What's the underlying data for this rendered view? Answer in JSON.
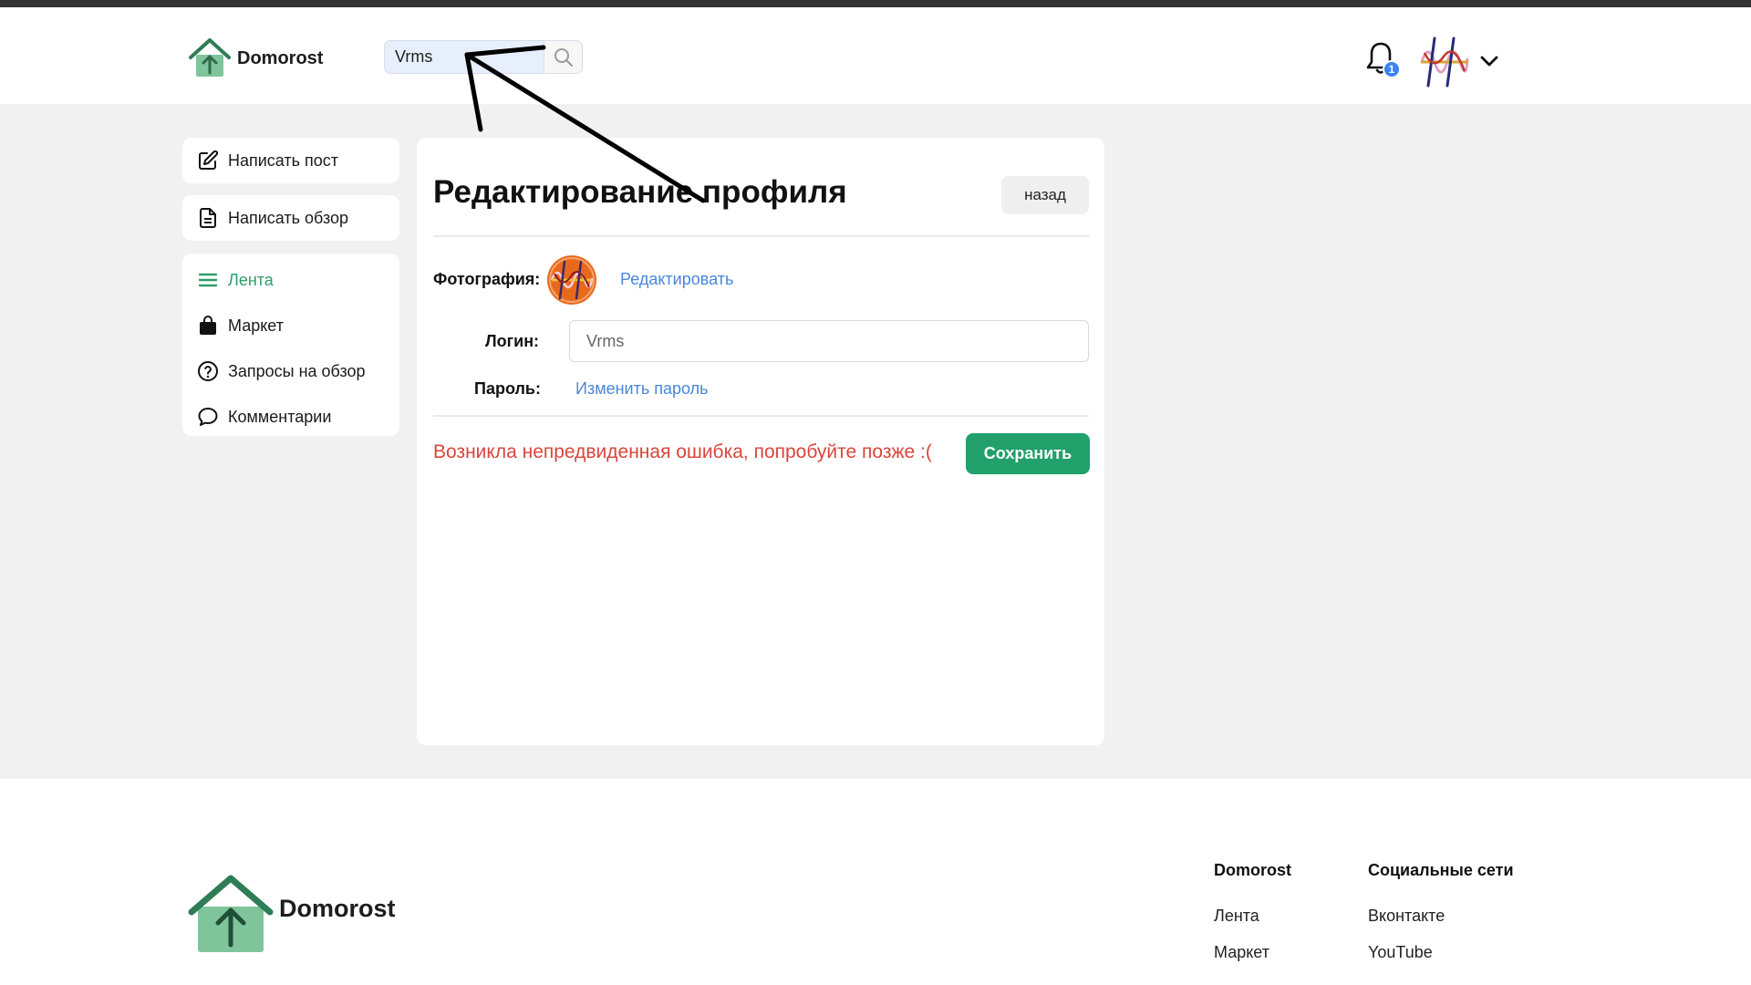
{
  "header": {
    "logo_text": "Domorost",
    "search": {
      "value": "Vrms",
      "placeholder": ""
    },
    "notifications_count": "1"
  },
  "sidebar": {
    "actions": [
      {
        "label": "Написать пост",
        "icon": "edit-icon"
      },
      {
        "label": "Написать обзор",
        "icon": "document-icon"
      }
    ],
    "nav": [
      {
        "label": "Лента",
        "icon": "menu-icon",
        "active": true
      },
      {
        "label": "Маркет",
        "icon": "shopping-bag-icon"
      },
      {
        "label": "Запросы на обзор",
        "icon": "question-icon"
      },
      {
        "label": "Комментарии",
        "icon": "comment-icon"
      }
    ]
  },
  "main": {
    "title": "Редактирование профиля",
    "back_label": "назад",
    "photo_label": "Фотография:",
    "photo_edit_link": "Редактировать",
    "login_label": "Логин:",
    "login_value": "Vrms",
    "password_label": "Пароль:",
    "password_link": "Изменить пароль",
    "error_text": "Возникла непредвиденная ошибка, попробуйте позже :(",
    "save_label": "Сохранить"
  },
  "footer": {
    "logo_text": "Domorost",
    "col1": {
      "heading": "Domorost",
      "links": [
        "Лента",
        "Маркет"
      ]
    },
    "col2": {
      "heading": "Социальные сети",
      "links": [
        "Вконтакте",
        "YouTube"
      ]
    }
  },
  "colors": {
    "accent_green": "#22a06b",
    "link_blue": "#4a86d8",
    "error_red": "#d9453b",
    "badge_blue": "#3b82f6"
  }
}
